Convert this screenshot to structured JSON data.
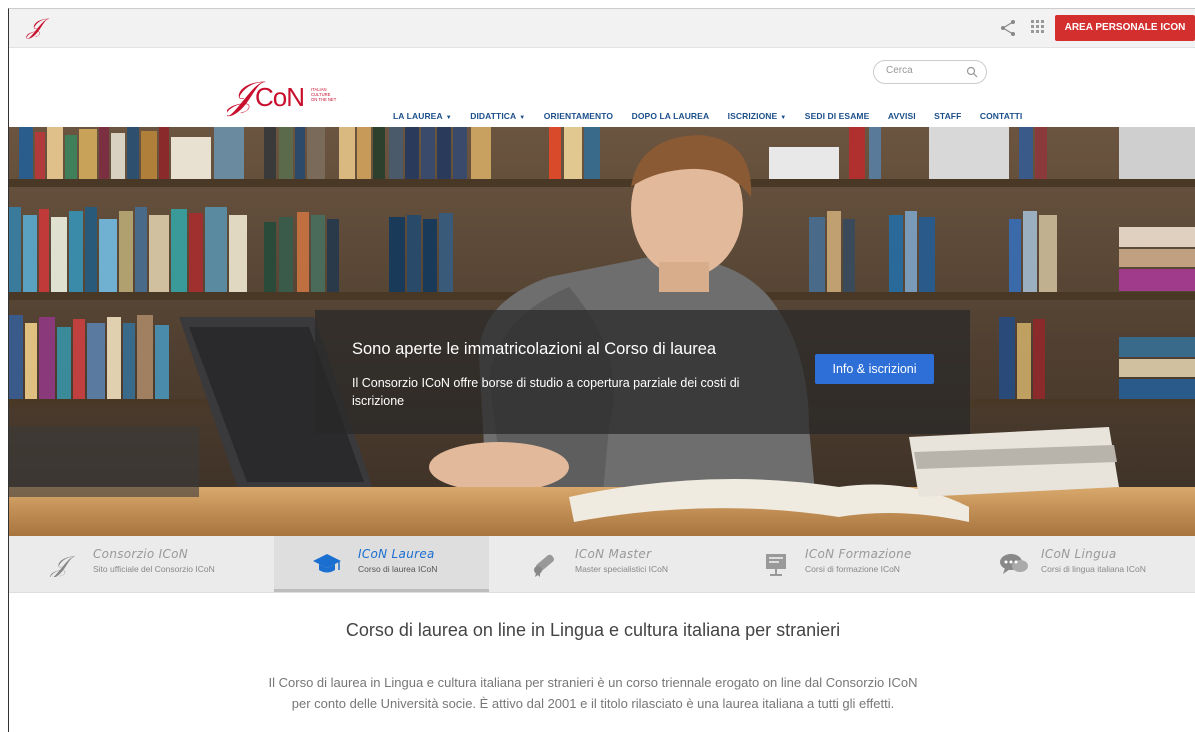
{
  "topbar": {
    "logo_icon": "icon-script-logo",
    "share_icon": "share-icon",
    "apps_icon": "grid-icon",
    "area_button": "AREA PERSONALE ICON",
    "brand_color": "#d32f2f"
  },
  "header": {
    "logo_text": "ITALIAN CULTURE ON THE NET",
    "search_placeholder": "Cerca",
    "nav": [
      {
        "label": "LA LAUREA",
        "dropdown": true
      },
      {
        "label": "DIDATTICA",
        "dropdown": true
      },
      {
        "label": "ORIENTAMENTO",
        "dropdown": false
      },
      {
        "label": "DOPO LA LAUREA",
        "dropdown": false
      },
      {
        "label": "ISCRIZIONE",
        "dropdown": true
      },
      {
        "label": "SEDI DI ESAME",
        "dropdown": false
      },
      {
        "label": "AVVISI",
        "dropdown": false
      },
      {
        "label": "STAFF",
        "dropdown": false
      },
      {
        "label": "CONTATTI",
        "dropdown": false
      }
    ]
  },
  "hero": {
    "title": "Sono aperte le immatricolazioni al Corso di laurea",
    "description": "Il Consorzio ICoN offre borse di studio a copertura parziale dei costi di iscrizione",
    "cta": "Info & iscrizioni"
  },
  "tabs": [
    {
      "name": "Consorzio ICoN",
      "sub": "Sito ufficiale del Consorzio ICoN",
      "icon": "script-logo-icon",
      "active": false
    },
    {
      "name": "ICoN Laurea",
      "sub": "Corso di laurea ICoN",
      "icon": "graduation-cap-icon",
      "active": true
    },
    {
      "name": "ICoN Master",
      "sub": "Master specialistici ICoN",
      "icon": "diploma-icon",
      "active": false
    },
    {
      "name": "ICoN Formazione",
      "sub": "Corsi di formazione ICoN",
      "icon": "presentation-board-icon",
      "active": false
    },
    {
      "name": "ICoN Lingua",
      "sub": "Corsi di lingua italiana ICoN",
      "icon": "speech-bubbles-icon",
      "active": false
    }
  ],
  "content": {
    "title": "Corso di laurea on line in Lingua e cultura italiana per stranieri",
    "body_line1": "Il Corso di laurea in Lingua e cultura italiana per stranieri è un corso triennale erogato on line dal Consorzio ICoN",
    "body_line2": "per conto delle Università socie. È attivo dal 2001 e il titolo rilasciato è una laurea italiana a tutti gli effetti."
  }
}
